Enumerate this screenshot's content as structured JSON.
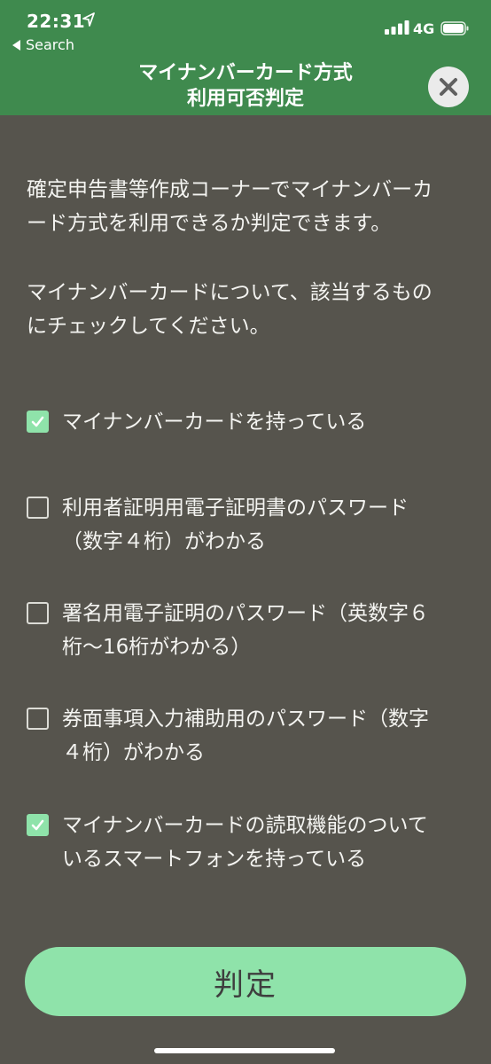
{
  "status_bar": {
    "time": "22:31",
    "back_label": "Search",
    "network": "4G"
  },
  "header": {
    "title_line1": "マイナンバーカード方式",
    "title_line2": "利用可否判定"
  },
  "intro": {
    "paragraph1_line1": "確定申告書等作成コーナーでマイナンバーカ",
    "paragraph1_line2": "ード方式を利用できるか判定できます。",
    "paragraph2_line1": "マイナンバーカードについて、該当するもの",
    "paragraph2_line2": "にチェックしてください。"
  },
  "checklist": [
    {
      "line1": "マイナンバーカードを持っている",
      "line2": "",
      "checked": true
    },
    {
      "line1": "利用者証明用電子証明書のパスワード",
      "line2": "（数字４桁）がわかる",
      "checked": false
    },
    {
      "line1": "署名用電子証明のパスワード（英数字６",
      "line2": "桁〜16桁がわかる）",
      "checked": false
    },
    {
      "line1": "券面事項入力補助用のパスワード（数字",
      "line2": "４桁）がわかる",
      "checked": false
    },
    {
      "line1": "マイナンバーカードの読取機能のついて",
      "line2": "いるスマートフォンを持っている",
      "checked": true
    }
  ],
  "judge_button": {
    "label": "判定"
  },
  "colors": {
    "header_bg": "#3f8a4e",
    "page_bg": "#56544d",
    "accent": "#8fe3aa"
  },
  "icons": {
    "status": [
      "location-arrow-icon",
      "back-triangle-icon",
      "signal-bars-icon",
      "battery-icon"
    ],
    "close": "close-icon",
    "check": "checkmark-icon"
  }
}
